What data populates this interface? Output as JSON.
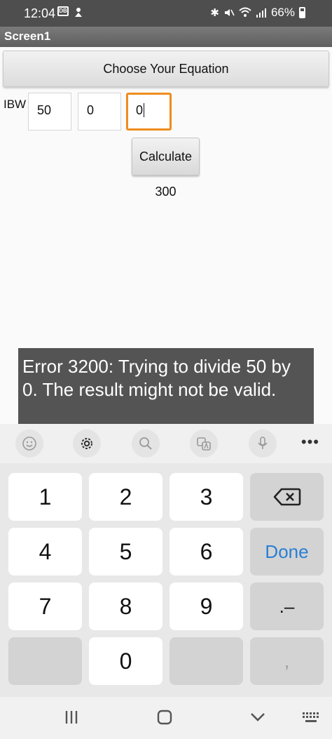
{
  "status_bar": {
    "time": "12:04",
    "battery_percent": "66%",
    "box_icon_text": "DB"
  },
  "title_bar": {
    "title": "Screen1"
  },
  "main": {
    "choose_button_label": "Choose Your Equation",
    "ibw_label": "IBW",
    "fields": [
      "50",
      "0",
      "0"
    ],
    "calculate_button_label": "Calculate",
    "result": "300"
  },
  "toast": {
    "message": "Error 3200: Trying to divide 50 by 0.  The result might not be valid."
  },
  "keyboard_toolbar": {
    "icons": [
      "emoji-icon",
      "settings-icon",
      "search-icon",
      "translate-icon",
      "microphone-icon"
    ],
    "more_label": "•••"
  },
  "keyboard": {
    "keys": [
      "1",
      "2",
      "3",
      "4",
      "5",
      "6",
      "Done",
      "7",
      "8",
      "9",
      ".–",
      "0",
      ","
    ]
  },
  "colors": {
    "accent_focus": "#ef8c1e",
    "done_blue": "#2a7fd4",
    "toast_bg": "#545454"
  }
}
